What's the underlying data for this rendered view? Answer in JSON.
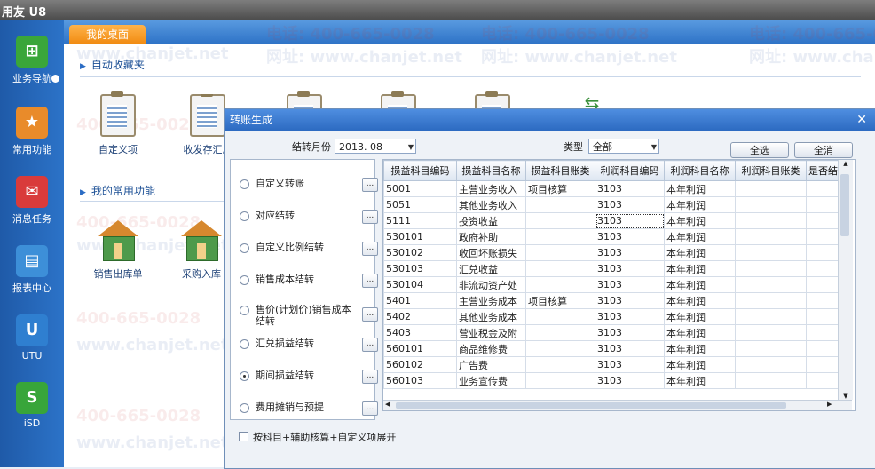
{
  "app": {
    "title": "用友 U8"
  },
  "nav": {
    "items": [
      {
        "label": "业务导航",
        "icon": "business-nav-icon"
      },
      {
        "label": "常用功能",
        "icon": "star-icon"
      },
      {
        "label": "消息任务",
        "icon": "message-icon"
      },
      {
        "label": "报表中心",
        "icon": "report-icon"
      },
      {
        "label": "UTU",
        "icon": "utu-icon"
      },
      {
        "label": "iSD",
        "icon": "isd-icon"
      }
    ]
  },
  "desktop": {
    "tab": "我的桌面",
    "favorites_title": "自动收藏夹",
    "common_title": "我的常用功能",
    "favorites": [
      "自定义项",
      "收发存汇总"
    ],
    "common": [
      "销售出库单",
      "采购入库"
    ],
    "watermark_phone": "电话: 400-665-0028",
    "watermark_site": "网址: www.chanjet.net",
    "watermark_phone_short": "400-665-0028",
    "watermark_site_short": "www.chanjet.net"
  },
  "dialog": {
    "title": "转账生成",
    "month_label": "结转月份",
    "month_value": "2013. 08",
    "type_label": "类型",
    "type_value": "全部",
    "select_all": "全选",
    "cancel_all": "全消",
    "options": [
      {
        "label": "自定义转账",
        "selected": false
      },
      {
        "label": "对应结转",
        "selected": false
      },
      {
        "label": "自定义比例结转",
        "selected": false
      },
      {
        "label": "销售成本结转",
        "selected": false
      },
      {
        "label": "售价(计划价)销售成本结转",
        "selected": false
      },
      {
        "label": "汇兑损益结转",
        "selected": false
      },
      {
        "label": "期间损益结转",
        "selected": true
      },
      {
        "label": "费用摊销与预提",
        "selected": false
      }
    ],
    "dots_label": "...",
    "expand_checkbox": "按科目+辅助核算+自定义项展开",
    "columns": [
      "损益科目编码",
      "损益科目名称",
      "损益科目账类",
      "利润科目编码",
      "利润科目名称",
      "利润科目账类",
      "是否结"
    ],
    "rows": [
      [
        "5001",
        "主营业务收入",
        "项目核算",
        "3103",
        "本年利润",
        "",
        ""
      ],
      [
        "5051",
        "其他业务收入",
        "",
        "3103",
        "本年利润",
        "",
        ""
      ],
      [
        "5111",
        "投资收益",
        "",
        "3103",
        "本年利润",
        "",
        ""
      ],
      [
        "530101",
        "政府补助",
        "",
        "3103",
        "本年利润",
        "",
        ""
      ],
      [
        "530102",
        "收回坏账损失",
        "",
        "3103",
        "本年利润",
        "",
        ""
      ],
      [
        "530103",
        "汇兑收益",
        "",
        "3103",
        "本年利润",
        "",
        ""
      ],
      [
        "530104",
        "非流动资产处",
        "",
        "3103",
        "本年利润",
        "",
        ""
      ],
      [
        "5401",
        "主营业务成本",
        "项目核算",
        "3103",
        "本年利润",
        "",
        ""
      ],
      [
        "5402",
        "其他业务成本",
        "",
        "3103",
        "本年利润",
        "",
        ""
      ],
      [
        "5403",
        "营业税金及附",
        "",
        "3103",
        "本年利润",
        "",
        ""
      ],
      [
        "560101",
        "商品维修费",
        "",
        "3103",
        "本年利润",
        "",
        ""
      ],
      [
        "560102",
        "广告费",
        "",
        "3103",
        "本年利润",
        "",
        ""
      ],
      [
        "560103",
        "业务宣传费",
        "",
        "3103",
        "本年利润",
        "",
        ""
      ]
    ],
    "selected_row": 2
  }
}
